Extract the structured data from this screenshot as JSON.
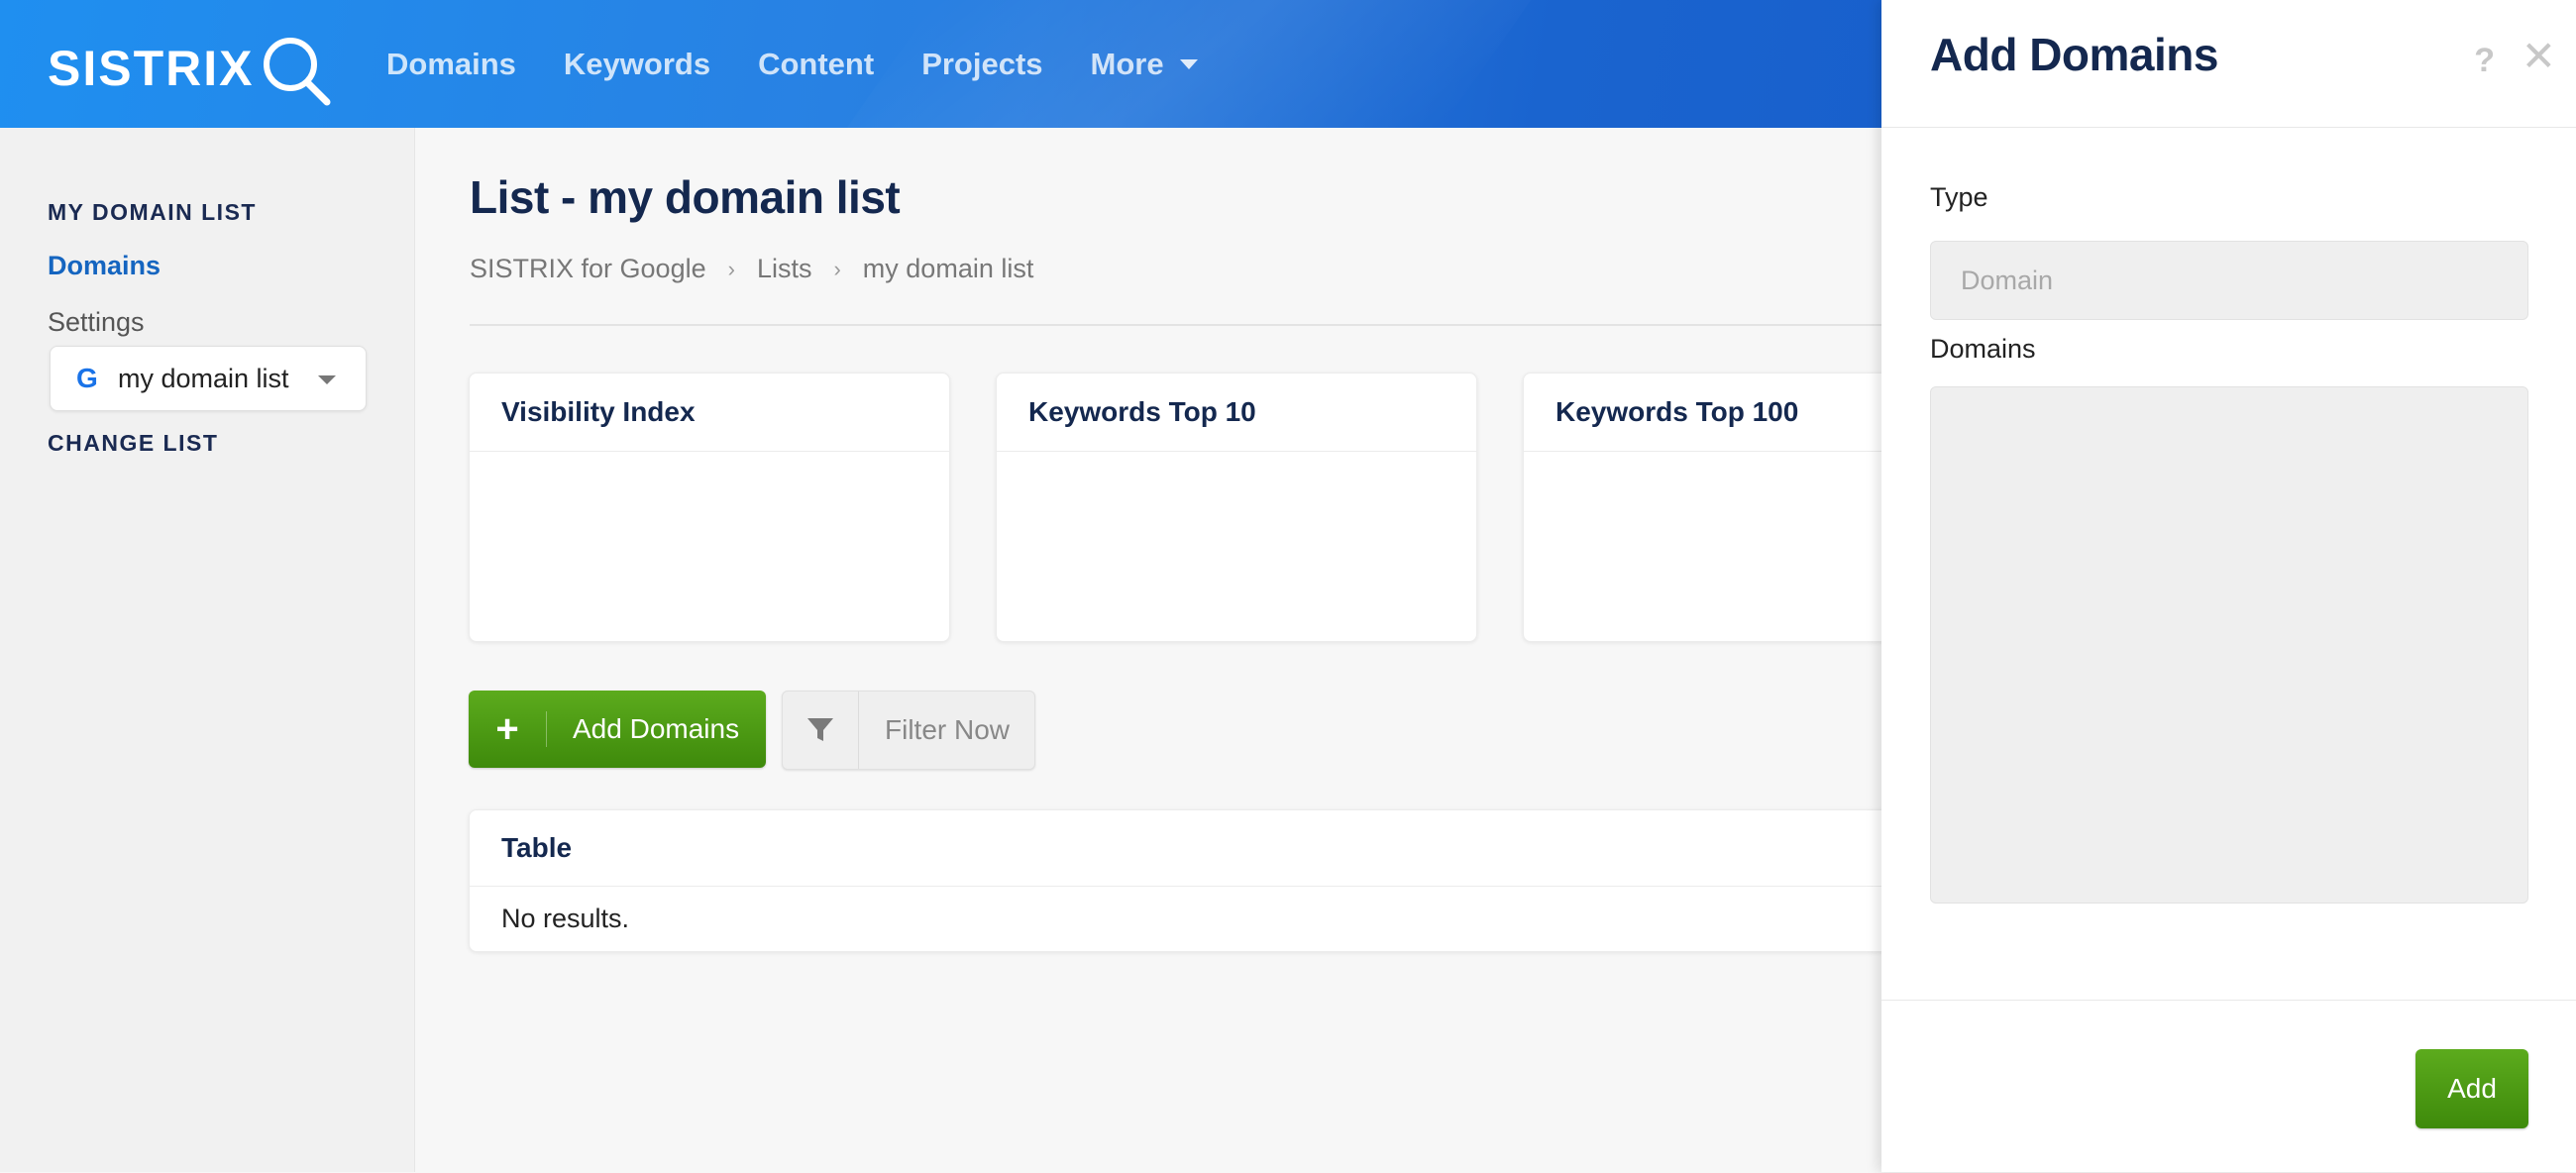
{
  "brand": {
    "logo_text": "SISTRIX"
  },
  "nav": {
    "items": [
      {
        "label": "Domains"
      },
      {
        "label": "Keywords"
      },
      {
        "label": "Content"
      },
      {
        "label": "Projects"
      },
      {
        "label": "More"
      }
    ]
  },
  "sidebar": {
    "section1_heading": "MY DOMAIN LIST",
    "links": [
      {
        "label": "Domains",
        "active": true
      },
      {
        "label": "Settings",
        "active": false
      }
    ],
    "section2_heading": "CHANGE LIST",
    "list_select": {
      "icon": "google-g-icon",
      "glyph": "G",
      "value": "my domain list"
    }
  },
  "main": {
    "title": "List - my domain list",
    "breadcrumb": [
      "SISTRIX for Google",
      "Lists",
      "my domain list"
    ],
    "cards": [
      {
        "title": "Visibility Index"
      },
      {
        "title": "Keywords Top 10"
      },
      {
        "title": "Keywords Top 100"
      }
    ],
    "add_button": {
      "icon": "plus-icon",
      "glyph": "+",
      "label": "Add Domains"
    },
    "filter_button": {
      "icon": "filter-icon",
      "label": "Filter Now"
    },
    "table": {
      "title": "Table",
      "empty_text": "No results."
    }
  },
  "panel": {
    "title": "Add Domains",
    "help_glyph": "?",
    "close_glyph": "✕",
    "type_label": "Type",
    "type_placeholder": "Domain",
    "domains_label": "Domains",
    "domains_value": "",
    "submit_label": "Add"
  },
  "colors": {
    "header_blue": "#1f8ff0",
    "accent_green": "#4c9a13",
    "link_blue": "#1565c0",
    "title_navy": "#14284f"
  }
}
